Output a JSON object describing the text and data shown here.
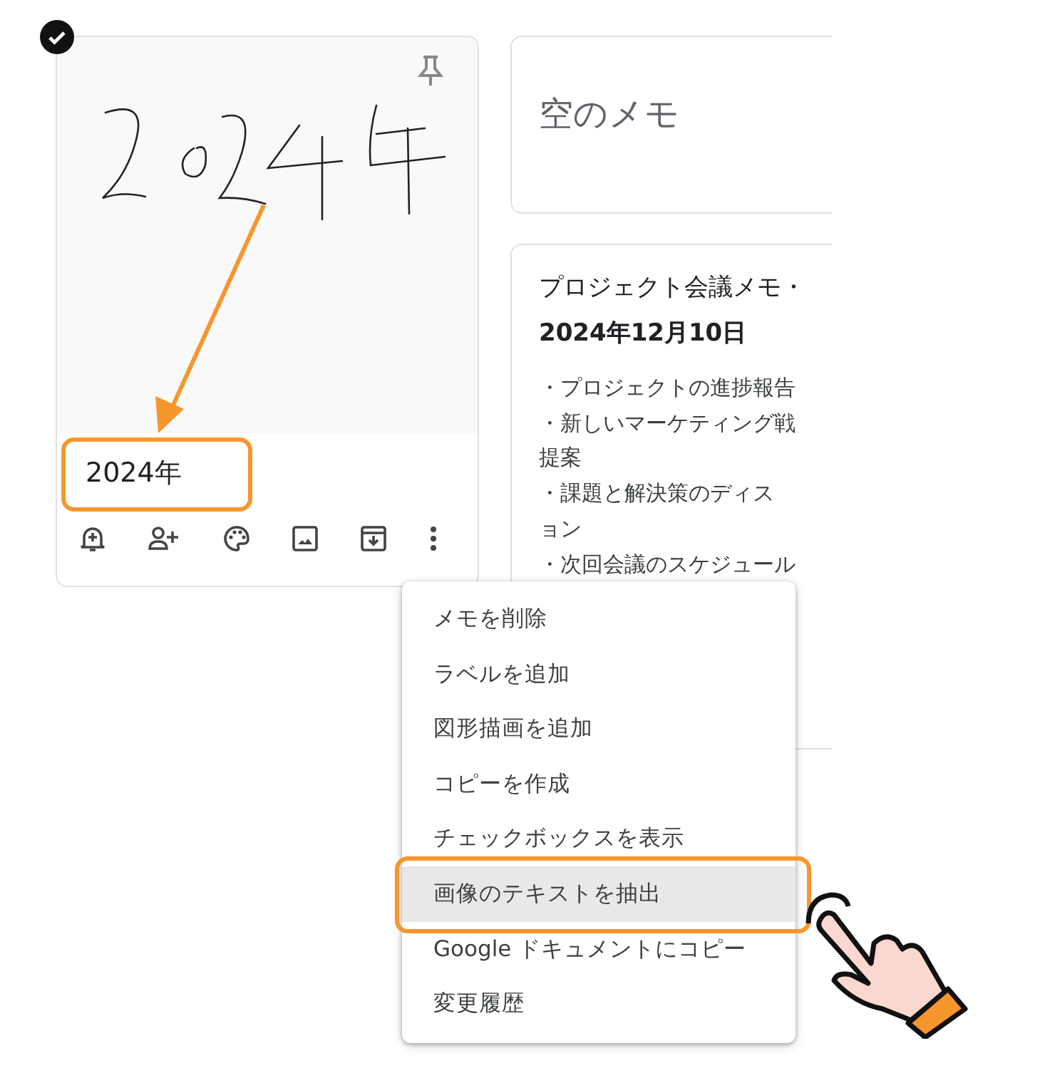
{
  "notes": [
    {
      "kind": "drawing",
      "selected": true,
      "title": "2024年"
    },
    {
      "kind": "empty",
      "selected": false,
      "title": "空のメモ"
    },
    {
      "kind": "text",
      "selected": false,
      "title_lines": [
        "プロジェクト会議メモ・",
        "2024年12月10日"
      ],
      "body_lines": [
        "・プロジェクトの進捗報告",
        "・新しいマーケティング戦",
        "提案",
        "・課題と解決策のディス",
        "ョン",
        "・次回会議のスケジュール"
      ]
    }
  ],
  "menu": {
    "items": [
      {
        "label": "メモを削除",
        "selected": false
      },
      {
        "label": "ラベルを追加",
        "selected": false
      },
      {
        "label": "図形描画を追加",
        "selected": false
      },
      {
        "label": "コピーを作成",
        "selected": false
      },
      {
        "label": "チェックボックスを表示",
        "selected": false
      },
      {
        "label": "画像のテキストを抽出",
        "selected": true
      },
      {
        "label": "Google ドキュメントにコピー",
        "selected": false
      },
      {
        "label": "変更履歴",
        "selected": false
      }
    ]
  }
}
